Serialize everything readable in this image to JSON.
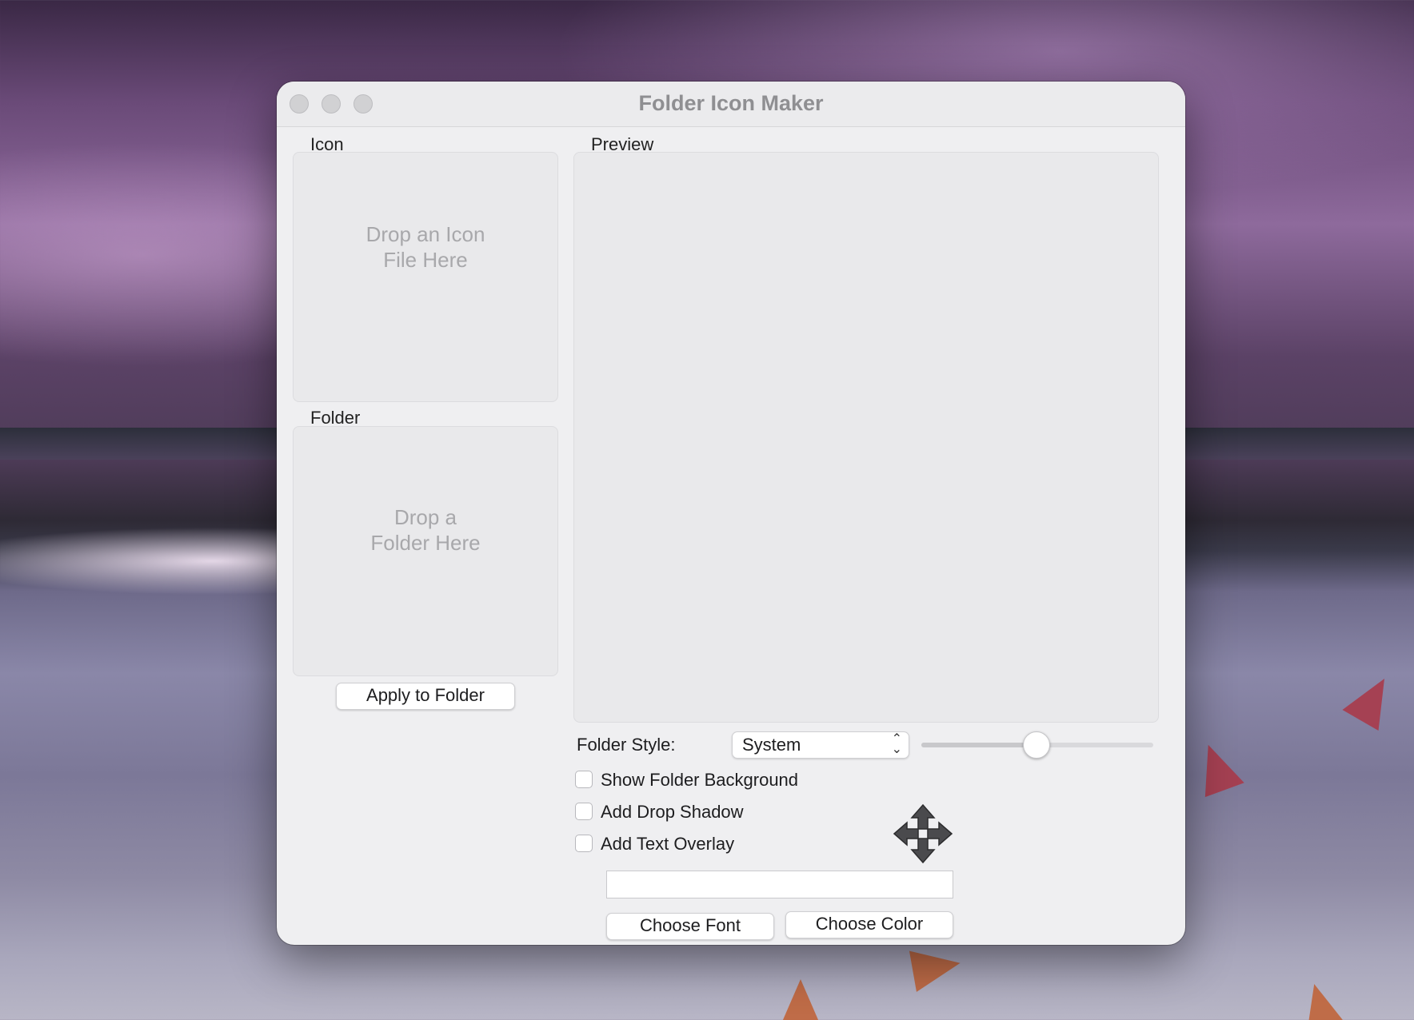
{
  "window": {
    "title": "Folder Icon Maker"
  },
  "icon_group": {
    "label": "Icon",
    "drop_hint_line1": "Drop an Icon",
    "drop_hint_line2": "File Here"
  },
  "folder_group": {
    "label": "Folder",
    "drop_hint_line1": "Drop a",
    "drop_hint_line2": "Folder Here"
  },
  "apply_button": "Apply to Folder",
  "preview": {
    "label": "Preview"
  },
  "folder_style": {
    "label": "Folder Style:",
    "selected": "System",
    "slider_value": 0.5
  },
  "options": {
    "show_background": {
      "label": "Show Folder Background",
      "checked": false
    },
    "drop_shadow": {
      "label": "Add Drop Shadow",
      "checked": false
    },
    "text_overlay": {
      "label": "Add Text Overlay",
      "checked": false
    }
  },
  "text_overlay_value": "",
  "buttons": {
    "choose_font": "Choose Font",
    "choose_color": "Choose Color"
  },
  "icons": {
    "move": "move-arrows-icon"
  }
}
